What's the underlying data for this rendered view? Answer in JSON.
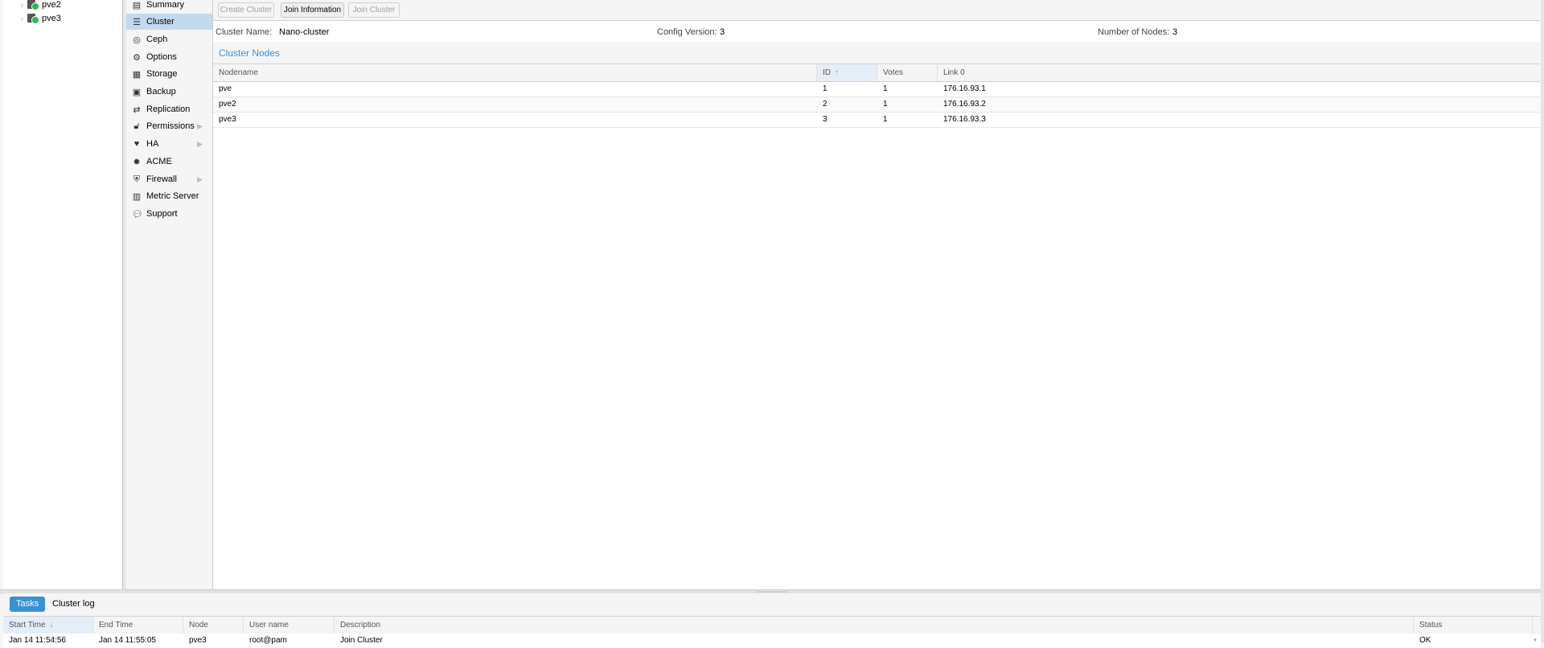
{
  "tree": {
    "nodes": [
      {
        "label": "pve2"
      },
      {
        "label": "pve3"
      }
    ]
  },
  "menu": {
    "items": [
      {
        "label": "Summary",
        "icon": "book-icon",
        "glyph": "▤",
        "selected": false,
        "submenu": false
      },
      {
        "label": "Cluster",
        "icon": "list-icon",
        "glyph": "☰",
        "selected": true,
        "submenu": false
      },
      {
        "label": "Ceph",
        "icon": "ceph-icon",
        "glyph": "◎",
        "selected": false,
        "submenu": false
      },
      {
        "label": "Options",
        "icon": "gear-icon",
        "glyph": "⚙",
        "selected": false,
        "submenu": false
      },
      {
        "label": "Storage",
        "icon": "database-icon",
        "glyph": "▦",
        "selected": false,
        "submenu": false
      },
      {
        "label": "Backup",
        "icon": "floppy-icon",
        "glyph": "▣",
        "selected": false,
        "submenu": false
      },
      {
        "label": "Replication",
        "icon": "retweet-icon",
        "glyph": "⇄",
        "selected": false,
        "submenu": false
      },
      {
        "label": "Permissions",
        "icon": "unlock-icon",
        "glyph": "🔓︎",
        "selected": false,
        "submenu": true
      },
      {
        "label": "HA",
        "icon": "heartbeat-icon",
        "glyph": "♥",
        "selected": false,
        "submenu": true
      },
      {
        "label": "ACME",
        "icon": "certificate-icon",
        "glyph": "✹",
        "selected": false,
        "submenu": false
      },
      {
        "label": "Firewall",
        "icon": "shield-icon",
        "glyph": "⛨",
        "selected": false,
        "submenu": true
      },
      {
        "label": "Metric Server",
        "icon": "bar-chart-icon",
        "glyph": "▥",
        "selected": false,
        "submenu": false
      },
      {
        "label": "Support",
        "icon": "comments-icon",
        "glyph": "💬︎",
        "selected": false,
        "submenu": false
      }
    ]
  },
  "toolbar": {
    "create_cluster": "Create Cluster",
    "join_information": "Join Information",
    "join_cluster": "Join Cluster"
  },
  "info": {
    "cluster_name_label": "Cluster Name:",
    "cluster_name": "Nano-cluster",
    "config_version_label": "Config Version:",
    "config_version": "3",
    "num_nodes_label": "Number of Nodes:",
    "num_nodes": "3"
  },
  "cluster_nodes": {
    "title": "Cluster Nodes",
    "columns": {
      "nodename": "Nodename",
      "id": "ID",
      "votes": "Votes",
      "link0": "Link 0"
    },
    "sort_glyph": "↑",
    "rows": [
      {
        "nodename": "pve",
        "id": "1",
        "votes": "1",
        "link0": "176.16.93.1"
      },
      {
        "nodename": "pve2",
        "id": "2",
        "votes": "1",
        "link0": "176.16.93.2"
      },
      {
        "nodename": "pve3",
        "id": "3",
        "votes": "1",
        "link0": "176.16.93.3"
      }
    ]
  },
  "bottom": {
    "tabs": {
      "tasks": "Tasks",
      "cluster_log": "Cluster log"
    },
    "columns": {
      "start_time": "Start Time",
      "start_sort_glyph": "↓",
      "end_time": "End Time",
      "node": "Node",
      "user_name": "User name",
      "description": "Description",
      "status": "Status"
    },
    "row": {
      "start_time": "Jan 14 11:54:56",
      "end_time": "Jan 14 11:55:05",
      "node": "pve3",
      "user_name": "root@pam",
      "description": "Join Cluster",
      "status": "OK"
    }
  },
  "colors": {
    "accent": "#3892d4",
    "selected_menu": "#c3d9ee",
    "status_ok": "#21bf4b"
  }
}
